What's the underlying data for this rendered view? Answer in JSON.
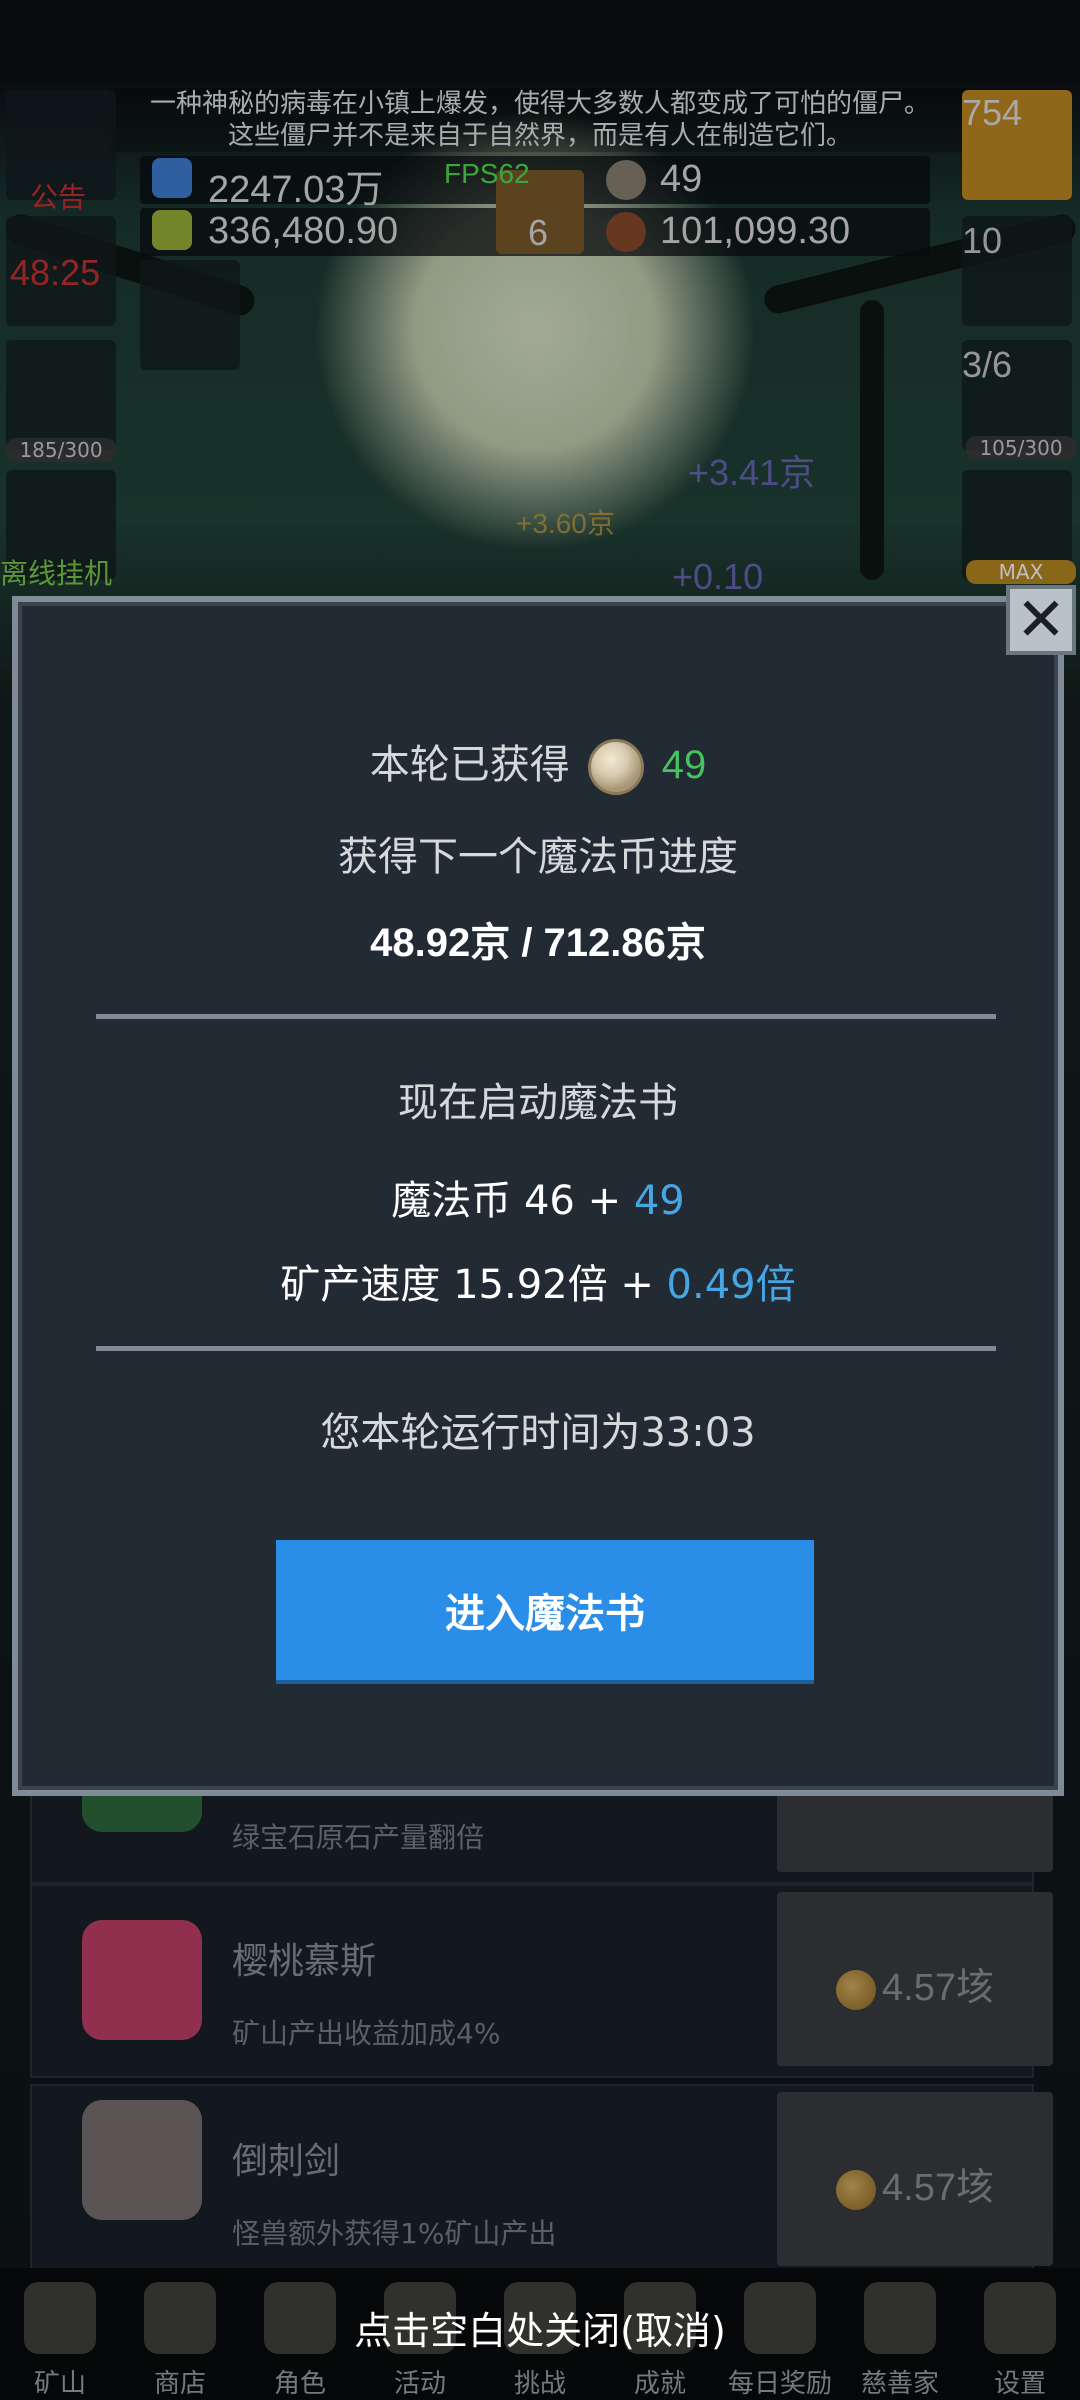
{
  "story": {
    "line1": "一种神秘的病毒在小镇上爆发，使得大多数人都变成了可怕的僵尸。",
    "line2": "这些僵尸并不是来自于自然界，而是有人在制造它们。"
  },
  "hud": {
    "fps": "FPS62",
    "blue_potion": "2247.03万",
    "green_potion": "336,480.90",
    "book_count": "6",
    "coin_count": "49",
    "meat_count": "101,099.30",
    "potion_count": "754",
    "chest_count": "10",
    "slime_count": "3/6",
    "left_timer": "48:25",
    "left_notice": "公告",
    "beer_progress": "185/300",
    "slime_progress": "105/300",
    "offline_label": "离线挂机",
    "sword_badge": "MAX",
    "float_1": "+3.41京",
    "float_2": "+3.60京",
    "float_3": "+0.10"
  },
  "modal": {
    "earned_label": "本轮已获得",
    "earned_value": "49",
    "next_coin_label": "获得下一个魔法币进度",
    "progress": "48.92京 / 712.86京",
    "start_now": "现在启动魔法书",
    "magic_coin_label": "魔法币 46 + ",
    "magic_coin_bonus": "49",
    "speed_label": "矿产速度 15.92倍 + ",
    "speed_bonus": "0.49倍",
    "runtime": "您本轮运行时间为33:03",
    "enter_button": "进入魔法书",
    "close_hint": "点击空白处关闭(取消)"
  },
  "list": [
    {
      "title": "",
      "desc": "绿宝石原石产量翻倍",
      "price": ""
    },
    {
      "title": "樱桃慕斯",
      "desc": "矿山产出收益加成4%",
      "price": "4.57垓"
    },
    {
      "title": "倒刺剑",
      "desc": "怪兽额外获得1%矿山产出",
      "price": "4.57垓"
    }
  ],
  "nav": [
    "矿山",
    "商店",
    "角色",
    "活动",
    "挑战",
    "成就",
    "每日奖励",
    "慈善家",
    "设置"
  ],
  "colors": {
    "accent": "#2a8ee8",
    "green": "#45c35f",
    "blue": "#46a6e5"
  }
}
